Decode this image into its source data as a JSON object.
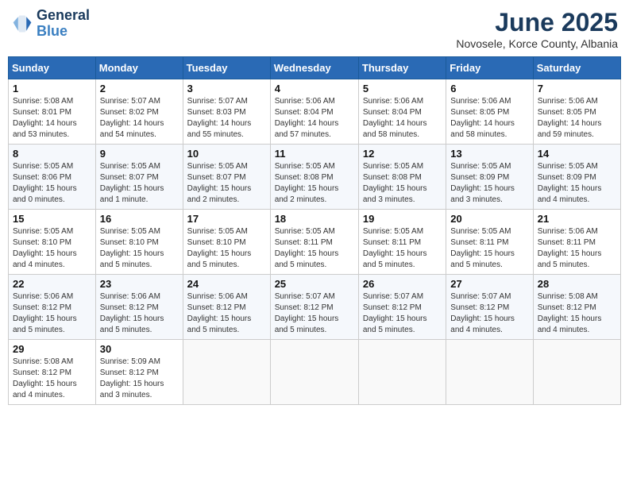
{
  "header": {
    "logo_line1": "General",
    "logo_line2": "Blue",
    "month": "June 2025",
    "location": "Novosele, Korce County, Albania"
  },
  "weekdays": [
    "Sunday",
    "Monday",
    "Tuesday",
    "Wednesday",
    "Thursday",
    "Friday",
    "Saturday"
  ],
  "weeks": [
    [
      {
        "day": "1",
        "info": "Sunrise: 5:08 AM\nSunset: 8:01 PM\nDaylight: 14 hours\nand 53 minutes."
      },
      {
        "day": "2",
        "info": "Sunrise: 5:07 AM\nSunset: 8:02 PM\nDaylight: 14 hours\nand 54 minutes."
      },
      {
        "day": "3",
        "info": "Sunrise: 5:07 AM\nSunset: 8:03 PM\nDaylight: 14 hours\nand 55 minutes."
      },
      {
        "day": "4",
        "info": "Sunrise: 5:06 AM\nSunset: 8:04 PM\nDaylight: 14 hours\nand 57 minutes."
      },
      {
        "day": "5",
        "info": "Sunrise: 5:06 AM\nSunset: 8:04 PM\nDaylight: 14 hours\nand 58 minutes."
      },
      {
        "day": "6",
        "info": "Sunrise: 5:06 AM\nSunset: 8:05 PM\nDaylight: 14 hours\nand 58 minutes."
      },
      {
        "day": "7",
        "info": "Sunrise: 5:06 AM\nSunset: 8:05 PM\nDaylight: 14 hours\nand 59 minutes."
      }
    ],
    [
      {
        "day": "8",
        "info": "Sunrise: 5:05 AM\nSunset: 8:06 PM\nDaylight: 15 hours\nand 0 minutes."
      },
      {
        "day": "9",
        "info": "Sunrise: 5:05 AM\nSunset: 8:07 PM\nDaylight: 15 hours\nand 1 minute."
      },
      {
        "day": "10",
        "info": "Sunrise: 5:05 AM\nSunset: 8:07 PM\nDaylight: 15 hours\nand 2 minutes."
      },
      {
        "day": "11",
        "info": "Sunrise: 5:05 AM\nSunset: 8:08 PM\nDaylight: 15 hours\nand 2 minutes."
      },
      {
        "day": "12",
        "info": "Sunrise: 5:05 AM\nSunset: 8:08 PM\nDaylight: 15 hours\nand 3 minutes."
      },
      {
        "day": "13",
        "info": "Sunrise: 5:05 AM\nSunset: 8:09 PM\nDaylight: 15 hours\nand 3 minutes."
      },
      {
        "day": "14",
        "info": "Sunrise: 5:05 AM\nSunset: 8:09 PM\nDaylight: 15 hours\nand 4 minutes."
      }
    ],
    [
      {
        "day": "15",
        "info": "Sunrise: 5:05 AM\nSunset: 8:10 PM\nDaylight: 15 hours\nand 4 minutes."
      },
      {
        "day": "16",
        "info": "Sunrise: 5:05 AM\nSunset: 8:10 PM\nDaylight: 15 hours\nand 5 minutes."
      },
      {
        "day": "17",
        "info": "Sunrise: 5:05 AM\nSunset: 8:10 PM\nDaylight: 15 hours\nand 5 minutes."
      },
      {
        "day": "18",
        "info": "Sunrise: 5:05 AM\nSunset: 8:11 PM\nDaylight: 15 hours\nand 5 minutes."
      },
      {
        "day": "19",
        "info": "Sunrise: 5:05 AM\nSunset: 8:11 PM\nDaylight: 15 hours\nand 5 minutes."
      },
      {
        "day": "20",
        "info": "Sunrise: 5:05 AM\nSunset: 8:11 PM\nDaylight: 15 hours\nand 5 minutes."
      },
      {
        "day": "21",
        "info": "Sunrise: 5:06 AM\nSunset: 8:11 PM\nDaylight: 15 hours\nand 5 minutes."
      }
    ],
    [
      {
        "day": "22",
        "info": "Sunrise: 5:06 AM\nSunset: 8:12 PM\nDaylight: 15 hours\nand 5 minutes."
      },
      {
        "day": "23",
        "info": "Sunrise: 5:06 AM\nSunset: 8:12 PM\nDaylight: 15 hours\nand 5 minutes."
      },
      {
        "day": "24",
        "info": "Sunrise: 5:06 AM\nSunset: 8:12 PM\nDaylight: 15 hours\nand 5 minutes."
      },
      {
        "day": "25",
        "info": "Sunrise: 5:07 AM\nSunset: 8:12 PM\nDaylight: 15 hours\nand 5 minutes."
      },
      {
        "day": "26",
        "info": "Sunrise: 5:07 AM\nSunset: 8:12 PM\nDaylight: 15 hours\nand 5 minutes."
      },
      {
        "day": "27",
        "info": "Sunrise: 5:07 AM\nSunset: 8:12 PM\nDaylight: 15 hours\nand 4 minutes."
      },
      {
        "day": "28",
        "info": "Sunrise: 5:08 AM\nSunset: 8:12 PM\nDaylight: 15 hours\nand 4 minutes."
      }
    ],
    [
      {
        "day": "29",
        "info": "Sunrise: 5:08 AM\nSunset: 8:12 PM\nDaylight: 15 hours\nand 4 minutes."
      },
      {
        "day": "30",
        "info": "Sunrise: 5:09 AM\nSunset: 8:12 PM\nDaylight: 15 hours\nand 3 minutes."
      },
      {
        "day": "",
        "info": ""
      },
      {
        "day": "",
        "info": ""
      },
      {
        "day": "",
        "info": ""
      },
      {
        "day": "",
        "info": ""
      },
      {
        "day": "",
        "info": ""
      }
    ]
  ]
}
